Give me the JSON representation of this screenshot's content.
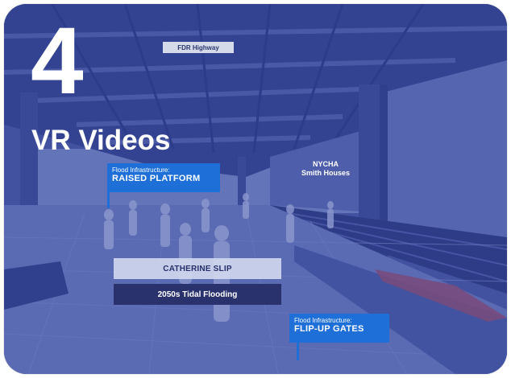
{
  "hero": {
    "number": "4",
    "title": "VR Videos"
  },
  "scene_labels": {
    "highway_sign": "FDR Highway",
    "nycha_line1": "NYCHA",
    "nycha_line2": "Smith Houses"
  },
  "tags": {
    "raised": {
      "small": "Flood Infrastructure:",
      "big": "RAISED PLATFORM"
    },
    "flip": {
      "small": "Flood Infrastructure:",
      "big": "FLIP-UP GATES"
    }
  },
  "buttons": {
    "location": "CATHERINE SLIP",
    "scenario": "2050s Tidal Flooding"
  },
  "colors": {
    "tint": "#3a4a94",
    "tag_blue": "#1e6fd8",
    "dark_button": "#2a326e"
  }
}
